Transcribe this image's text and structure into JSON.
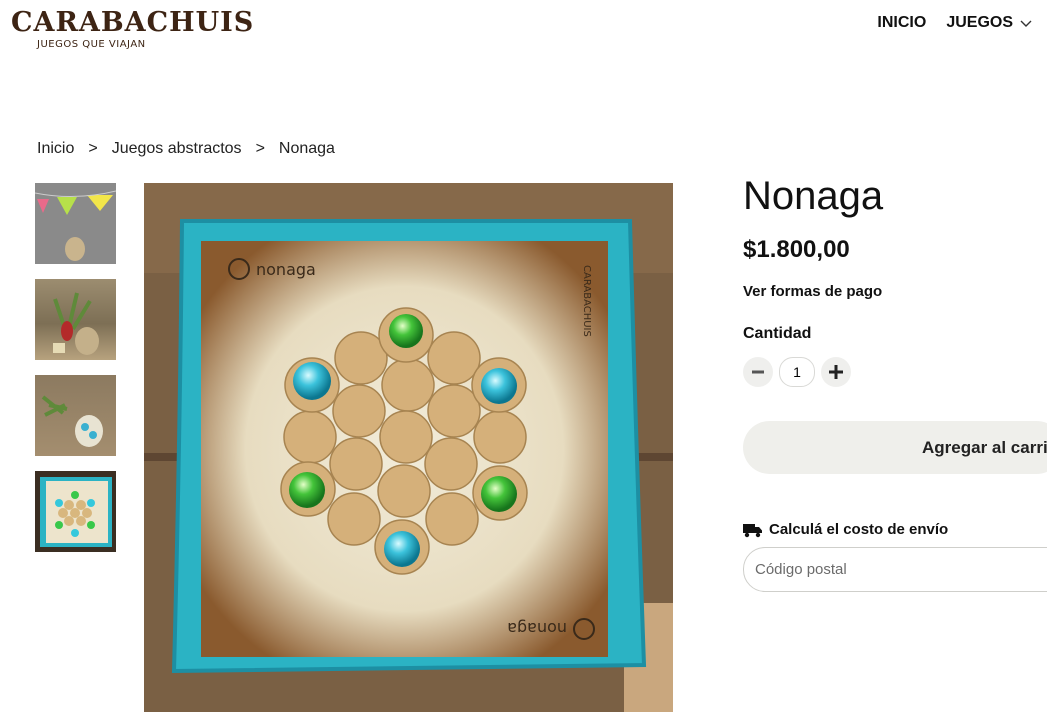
{
  "brand": {
    "name": "CARABACHUIS",
    "tagline": "JUEGOS QUE VIAJAN"
  },
  "nav": {
    "items": [
      {
        "label": "INICIO"
      },
      {
        "label": "JUEGOS"
      }
    ]
  },
  "breadcrumb": {
    "items": [
      "Inicio",
      "Juegos abstractos",
      "Nonaga"
    ],
    "separator": ">"
  },
  "product": {
    "title": "Nonaga",
    "price": "$1.800,00",
    "payment_link": "Ver formas de pago",
    "quantity_label": "Cantidad",
    "quantity": "1",
    "add_to_cart": "Agregar al carrito",
    "shipping_label": "Calculá el costo de envío",
    "zip_placeholder": "Código postal"
  },
  "board": {
    "label": "nonaga",
    "brand": "CARABACHUIS"
  },
  "gallery": {
    "thumbnail_count": 4,
    "selected": 4
  },
  "colors": {
    "accent_bg": "#efefeb",
    "board_border": "#2bb3c4",
    "wood": "#7e6547"
  },
  "icons": [
    "chevron-down-icon",
    "minus-icon",
    "plus-icon",
    "truck-icon"
  ]
}
